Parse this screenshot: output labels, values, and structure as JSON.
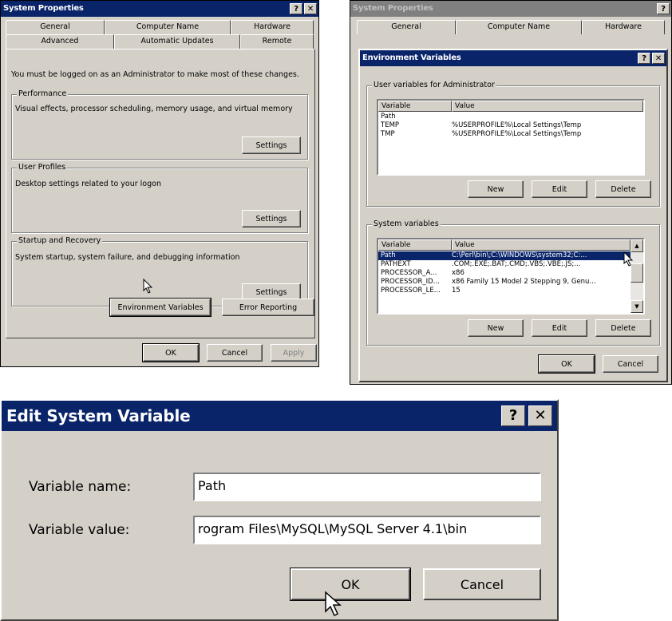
{
  "sysprops": {
    "title": "System Properties",
    "tabs_top": [
      "General",
      "Computer Name",
      "Hardware"
    ],
    "tabs_bottom": [
      "Advanced",
      "Automatic Updates",
      "Remote"
    ],
    "admin_note": "You must be logged on as an Administrator to make most of these changes.",
    "performance": {
      "label": "Performance",
      "desc": "Visual effects, processor scheduling, memory usage, and virtual memory",
      "button": "Settings"
    },
    "user_profiles": {
      "label": "User Profiles",
      "desc": "Desktop settings related to your logon",
      "button": "Settings"
    },
    "startup": {
      "label": "Startup and Recovery",
      "desc": "System startup, system failure, and debugging information",
      "button": "Settings"
    },
    "env_button": "Environment Variables",
    "error_button": "Error Reporting",
    "ok": "OK",
    "cancel": "Cancel",
    "apply": "Apply"
  },
  "envvars": {
    "bg_title": "System Properties",
    "bg_tabs": [
      "General",
      "Computer Name",
      "Hardware"
    ],
    "title": "Environment Variables",
    "user_group": "User variables for Administrator",
    "col_variable": "Variable",
    "col_value": "Value",
    "user_rows": [
      {
        "var": "Path",
        "val": ""
      },
      {
        "var": "TEMP",
        "val": "%USERPROFILE%\\Local Settings\\Temp"
      },
      {
        "var": "TMP",
        "val": "%USERPROFILE%\\Local Settings\\Temp"
      }
    ],
    "user_new": "New",
    "user_edit": "Edit",
    "user_delete": "Delete",
    "sys_group": "System variables",
    "sys_rows": [
      {
        "var": "Path",
        "val": "C:\\Perl\\bin\\;C:\\WINDOWS\\system32;C:..."
      },
      {
        "var": "PATHEXT",
        "val": ".COM;.EXE;.BAT;.CMD;.VBS;.VBE;.JS;..."
      },
      {
        "var": "PROCESSOR_A...",
        "val": "x86"
      },
      {
        "var": "PROCESSOR_ID...",
        "val": "x86 Family 15 Model 2 Stepping 9, Genu..."
      },
      {
        "var": "PROCESSOR_LE...",
        "val": "15"
      }
    ],
    "sys_new": "New",
    "sys_edit": "Edit",
    "sys_delete": "Delete",
    "ok": "OK",
    "cancel": "Cancel"
  },
  "editvar": {
    "title": "Edit System Variable",
    "name_label": "Variable name:",
    "name_value": "Path",
    "value_label": "Variable value:",
    "value_value": "rogram Files\\MySQL\\MySQL Server 4.1\\bin",
    "ok": "OK",
    "cancel": "Cancel"
  }
}
